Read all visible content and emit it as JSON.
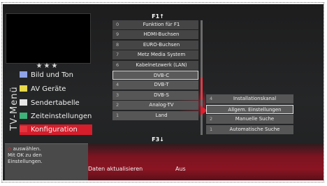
{
  "sidebar": {
    "title": "TV-Menü",
    "stars": "★★★",
    "items": [
      {
        "label": "Bild und Ton",
        "color": "#8fa3e6"
      },
      {
        "label": "AV Geräte",
        "color": "#e8d84a"
      },
      {
        "label": "Sendertabelle",
        "color": "#e6e6e6"
      },
      {
        "label": "Zeiteinstellungen",
        "color": "#3eb37a"
      },
      {
        "label": "Konfiguration",
        "color": "#e5353f"
      }
    ]
  },
  "help": {
    "line1": "auswählen.",
    "line2": "Mit OK zu den",
    "line3": "Einstellungen."
  },
  "status": {
    "left": "Daten aktualisieren",
    "right": "Aus"
  },
  "menu": {
    "header": "F1↑",
    "footer": "F3↓",
    "rows": [
      {
        "num": "0",
        "label": "Funktion für F1"
      },
      {
        "num": "9",
        "label": "HDMI-Buchsen"
      },
      {
        "num": "8",
        "label": "EURO-Buchsen"
      },
      {
        "num": "7",
        "label": "Metz Media System"
      },
      {
        "num": "6",
        "label": "Kabelnetzwerk (LAN)"
      },
      {
        "num": "",
        "label": "DVB-C"
      },
      {
        "num": "4",
        "label": "DVB-T"
      },
      {
        "num": "3",
        "label": "DVB-S"
      },
      {
        "num": "2",
        "label": "Analog-TV"
      },
      {
        "num": "1",
        "label": "Land"
      }
    ]
  },
  "submenu": {
    "rows": [
      {
        "num": "4",
        "label": "Installationskanal"
      },
      {
        "num": "",
        "label": "Allgem. Einstellungen"
      },
      {
        "num": "2",
        "label": "Manuelle Suche"
      },
      {
        "num": "1",
        "label": "Automatische Suche"
      }
    ]
  }
}
